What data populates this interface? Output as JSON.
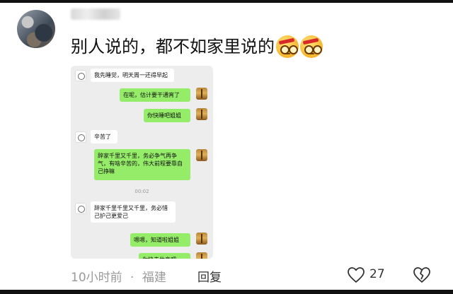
{
  "comment": {
    "text": "别人说的，都不如家里说的",
    "emojis": [
      "grimace-emoji",
      "grimace-emoji"
    ]
  },
  "chat_screenshot": {
    "messages": [
      {
        "side": "left",
        "text": "我先睡觉，明天周一还得早起"
      },
      {
        "side": "right",
        "text": "在呢，估计要干通宵了"
      },
      {
        "side": "right",
        "text": "你快睡吧姐姐"
      },
      {
        "side": "left",
        "text": "辛苦了"
      },
      {
        "side": "right",
        "text": "辞家千里又千里，务必争气再争气，有啥辛苦的，伟大前程要靠自己挣嘛"
      },
      {
        "side": "center",
        "text": "00:02"
      },
      {
        "side": "left",
        "text": "辞家千里千里又千里，务必惜己护己更爱己"
      },
      {
        "side": "right",
        "text": "嗯嗯，知道啦姐姐"
      },
      {
        "side": "right",
        "text": "你快去休息吧"
      }
    ]
  },
  "meta": {
    "time": "10小时前",
    "separator": "·",
    "location": "福建",
    "reply_label": "回复",
    "like_count": "27"
  },
  "colors": {
    "green_bubble": "#95ec69",
    "chat_background": "#ededed",
    "meta_gray": "#9a9a9a"
  }
}
